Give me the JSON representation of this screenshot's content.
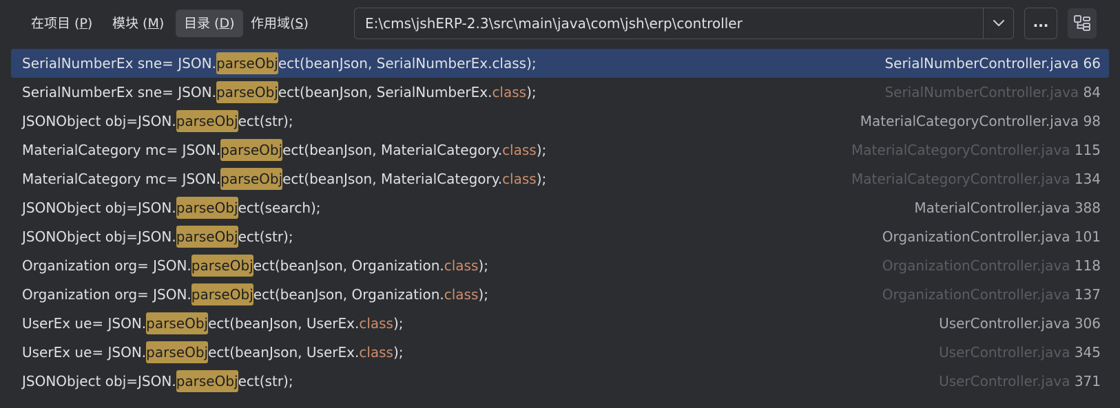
{
  "toolbar": {
    "scopes": [
      {
        "label": "在项目 (",
        "mnemonic": "P",
        "suffix": ")",
        "selected": false
      },
      {
        "label": "模块 (",
        "mnemonic": "M",
        "suffix": ")",
        "selected": false
      },
      {
        "label": "目录 (",
        "mnemonic": "D",
        "suffix": ")",
        "selected": true
      },
      {
        "label": "作用域(",
        "mnemonic": "S",
        "suffix": ")",
        "selected": false
      }
    ],
    "directory_path": "E:\\cms\\jshERP-2.3\\src\\main\\java\\com\\jsh\\erp\\controller",
    "browse_label": "...",
    "dropdown_icon": "chevron-down-icon",
    "tree_icon": "tree-view-icon"
  },
  "results": [
    {
      "pre": "SerialNumberEx sne= JSON.",
      "match": "parseObj",
      "post": "ect(beanJson, SerialNumberEx.",
      "kw": "class",
      "end": ");",
      "file": "SerialNumberController.java",
      "line": "66",
      "selected": true,
      "dim": false
    },
    {
      "pre": "SerialNumberEx sne= JSON.",
      "match": "parseObj",
      "post": "ect(beanJson, SerialNumberEx.",
      "kw": "class",
      "end": ");",
      "file": "SerialNumberController.java",
      "line": "84",
      "selected": false,
      "dim": true
    },
    {
      "pre": "JSONObject obj=JSON.",
      "match": "parseObj",
      "post": "ect(str);",
      "kw": "",
      "end": "",
      "file": "MaterialCategoryController.java",
      "line": "98",
      "selected": false,
      "dim": false
    },
    {
      "pre": "MaterialCategory mc= JSON.",
      "match": "parseObj",
      "post": "ect(beanJson, MaterialCategory.",
      "kw": "class",
      "end": ");",
      "file": "MaterialCategoryController.java",
      "line": "115",
      "selected": false,
      "dim": true
    },
    {
      "pre": "MaterialCategory mc= JSON.",
      "match": "parseObj",
      "post": "ect(beanJson, MaterialCategory.",
      "kw": "class",
      "end": ");",
      "file": "MaterialCategoryController.java",
      "line": "134",
      "selected": false,
      "dim": true
    },
    {
      "pre": "JSONObject obj=JSON.",
      "match": "parseObj",
      "post": "ect(search);",
      "kw": "",
      "end": "",
      "file": "MaterialController.java",
      "line": "388",
      "selected": false,
      "dim": false
    },
    {
      "pre": "JSONObject obj=JSON.",
      "match": "parseObj",
      "post": "ect(str);",
      "kw": "",
      "end": "",
      "file": "OrganizationController.java",
      "line": "101",
      "selected": false,
      "dim": false
    },
    {
      "pre": "Organization org= JSON.",
      "match": "parseObj",
      "post": "ect(beanJson, Organization.",
      "kw": "class",
      "end": ");",
      "file": "OrganizationController.java",
      "line": "118",
      "selected": false,
      "dim": true
    },
    {
      "pre": "Organization org= JSON.",
      "match": "parseObj",
      "post": "ect(beanJson, Organization.",
      "kw": "class",
      "end": ");",
      "file": "OrganizationController.java",
      "line": "137",
      "selected": false,
      "dim": true
    },
    {
      "pre": "UserEx ue= JSON.",
      "match": "parseObj",
      "post": "ect(beanJson, UserEx.",
      "kw": "class",
      "end": ");",
      "file": "UserController.java",
      "line": "306",
      "selected": false,
      "dim": false
    },
    {
      "pre": "UserEx ue= JSON.",
      "match": "parseObj",
      "post": "ect(beanJson, UserEx.",
      "kw": "class",
      "end": ");",
      "file": "UserController.java",
      "line": "345",
      "selected": false,
      "dim": true
    },
    {
      "pre": "JSONObject obj=JSON.",
      "match": "parseObj",
      "post": "ect(str);",
      "kw": "",
      "end": "",
      "file": "UserController.java",
      "line": "371",
      "selected": false,
      "dim": true
    }
  ],
  "colors": {
    "background": "#2b2d30",
    "selection": "#2e436e",
    "match_highlight": "#b59549",
    "keyword": "#cf8e6d"
  }
}
